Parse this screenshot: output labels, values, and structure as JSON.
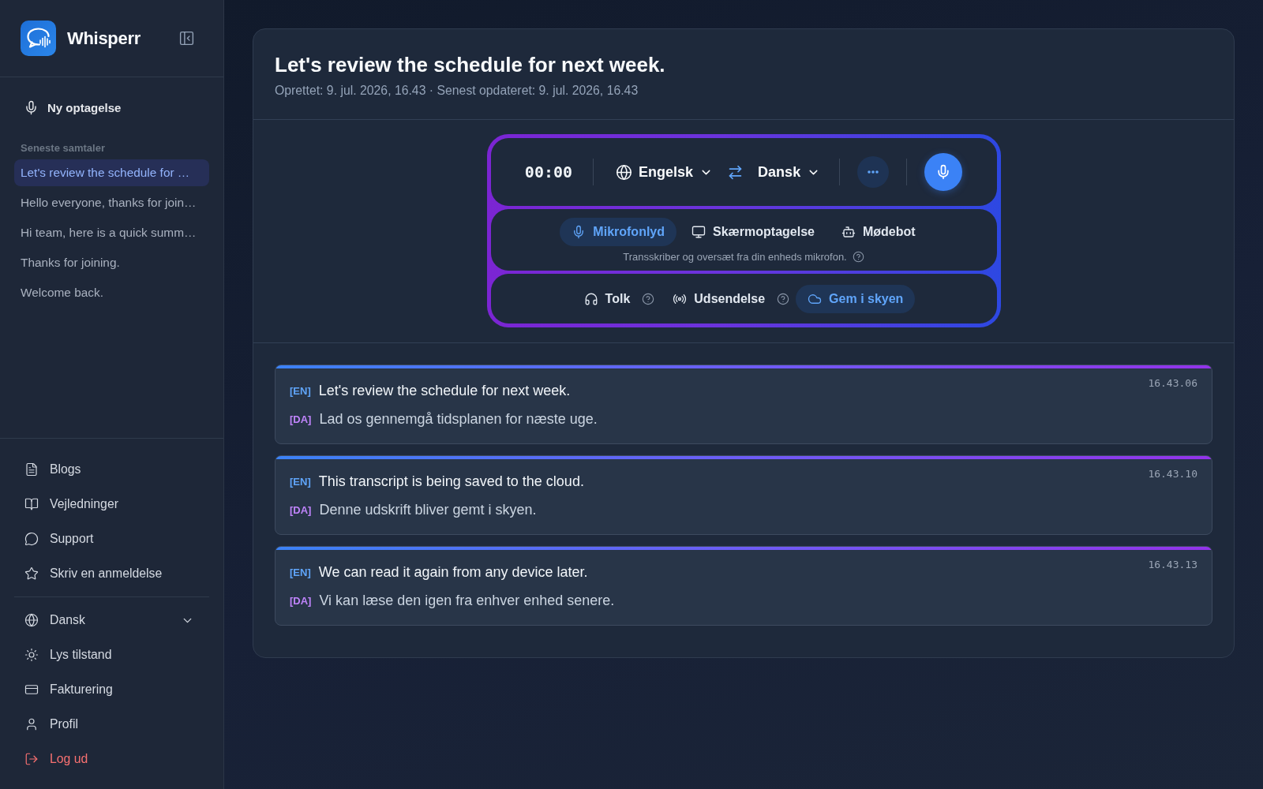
{
  "sidebar": {
    "brand": "Whisperr",
    "new_recording": "Ny optagelse",
    "recent_heading": "Seneste samtaler",
    "recent": [
      {
        "label": "Let's review the schedule for …",
        "selected": true
      },
      {
        "label": "Hello everyone, thanks for join…",
        "selected": false
      },
      {
        "label": "Hi team, here is a quick summ…",
        "selected": false
      },
      {
        "label": "Thanks for joining.",
        "selected": false
      },
      {
        "label": "Welcome back.",
        "selected": false
      }
    ],
    "links": [
      {
        "kind": "blog",
        "label": "Blogs"
      },
      {
        "kind": "guides",
        "label": "Vejledninger"
      },
      {
        "kind": "support",
        "label": "Support"
      },
      {
        "kind": "review",
        "label": "Skriv en anmeldelse"
      }
    ],
    "settings": [
      {
        "kind": "language",
        "label": "Dansk"
      },
      {
        "kind": "theme",
        "label": "Lys tilstand"
      },
      {
        "kind": "billing",
        "label": "Fakturering"
      },
      {
        "kind": "profile",
        "label": "Profil"
      },
      {
        "kind": "logout",
        "label": "Log ud"
      }
    ]
  },
  "conversation": {
    "title": "Let's review the schedule for next week.",
    "meta": "Oprettet: 9. jul. 2026, 16.43 · Senest opdateret: 9. jul. 2026, 16.43"
  },
  "recorder": {
    "timer": "00:00",
    "source_language": "Engelsk",
    "target_language": "Dansk",
    "modes": [
      {
        "kind": "microphone",
        "label": "Mikrofonlyd",
        "selected": true
      },
      {
        "kind": "screen",
        "label": "Skærmoptagelse",
        "selected": false
      },
      {
        "kind": "bot",
        "label": "Mødebot",
        "selected": false
      }
    ],
    "mode_hint": "Transskriber og oversæt fra din enheds mikrofon.",
    "options": [
      {
        "kind": "interpreter",
        "label": "Tolk",
        "on": false,
        "help": true
      },
      {
        "kind": "broadcast",
        "label": "Udsendelse",
        "on": false,
        "help": true
      },
      {
        "kind": "cloud",
        "label": "Gem i skyen",
        "on": true,
        "help": false
      }
    ]
  },
  "transcript": [
    {
      "time": "16.43.06",
      "lines": [
        {
          "kind": "source",
          "tag": "[EN]",
          "text": "Let's review the schedule for next week."
        },
        {
          "kind": "translation",
          "tag": "[DA]",
          "text": "Lad os gennemgå tidsplanen for næste uge."
        }
      ]
    },
    {
      "time": "16.43.10",
      "lines": [
        {
          "kind": "source",
          "tag": "[EN]",
          "text": "This transcript is being saved to the cloud."
        },
        {
          "kind": "translation",
          "tag": "[DA]",
          "text": "Denne udskrift bliver gemt i skyen."
        }
      ]
    },
    {
      "time": "16.43.13",
      "lines": [
        {
          "kind": "source",
          "tag": "[EN]",
          "text": "We can read it again from any device later."
        },
        {
          "kind": "translation",
          "tag": "[DA]",
          "text": "Vi kan læse den igen fra enhver enhed senere."
        }
      ]
    }
  ]
}
